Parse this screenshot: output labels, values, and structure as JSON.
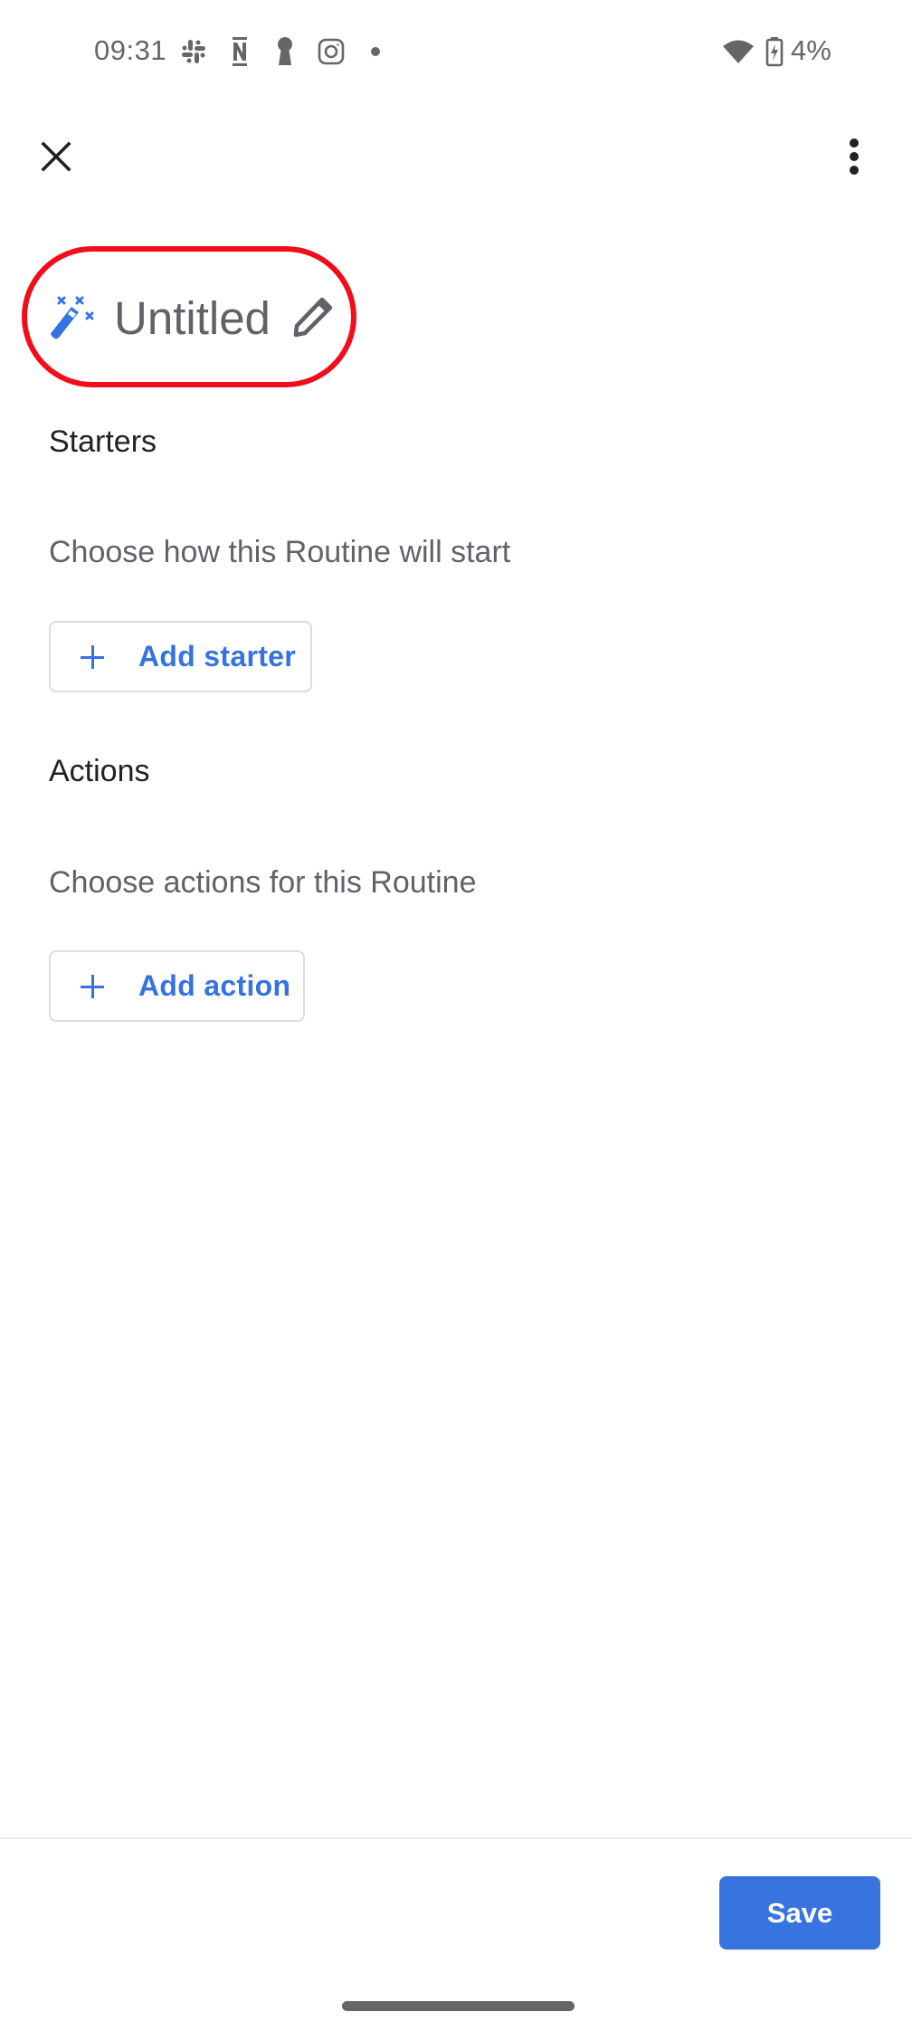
{
  "status_bar": {
    "time": "09:31",
    "notification_icons": [
      "slack-icon",
      "notion-icon",
      "keyhole-icon",
      "instagram-icon",
      "more-notifications-dot"
    ],
    "wifi_icon": "wifi-icon",
    "battery_icon": "battery-charging-icon",
    "battery_percent": "4%"
  },
  "toolbar": {
    "close_icon": "close-icon",
    "more_icon": "more-vert-icon"
  },
  "routine": {
    "title": "Untitled",
    "title_icon": "magic-wand-icon",
    "edit_icon": "pencil-icon",
    "highlight_color": "#f20d1a"
  },
  "starters": {
    "heading": "Starters",
    "description": "Choose how this Routine will start",
    "add_button_label": "Add starter"
  },
  "actions": {
    "heading": "Actions",
    "description": "Choose actions for this Routine",
    "add_button_label": "Add action"
  },
  "footer": {
    "save_label": "Save"
  },
  "colors": {
    "accent": "#3574e0",
    "save_button": "#3874e0",
    "heading_text": "#202124",
    "secondary_text": "#5f6368"
  }
}
